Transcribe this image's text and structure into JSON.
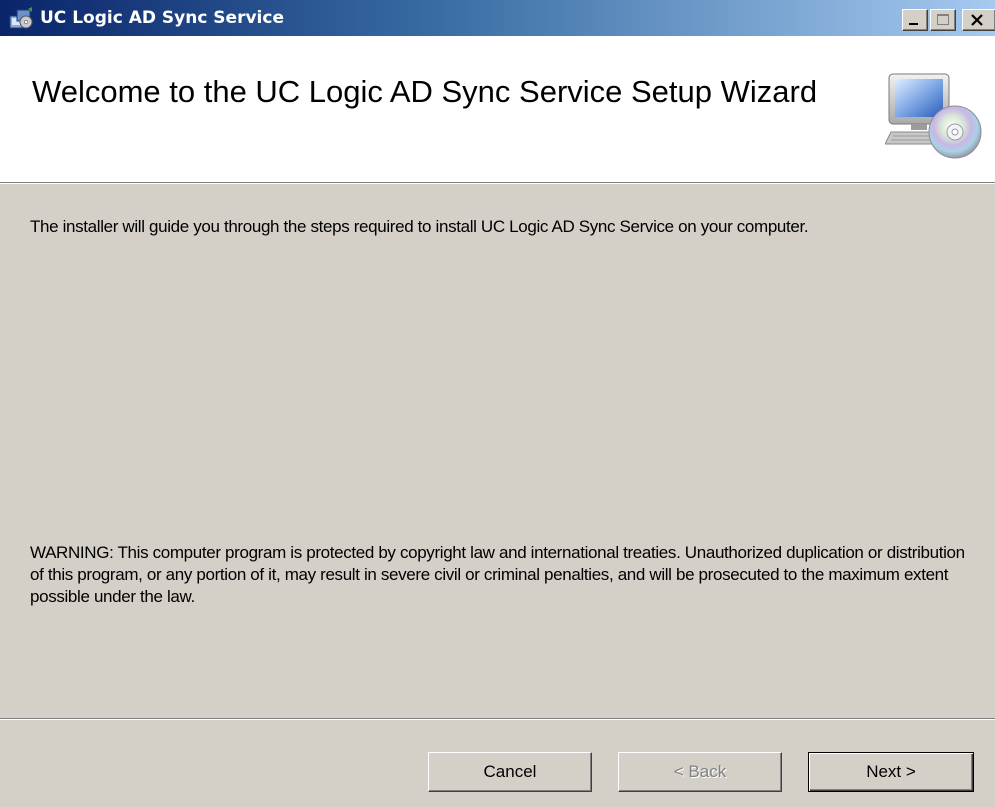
{
  "window": {
    "title": "UC Logic AD Sync Service",
    "icon": "installer-icon",
    "controls": {
      "minimize": "minimize-icon",
      "maximize": "maximize-icon",
      "close": "close-icon"
    }
  },
  "header": {
    "title": "Welcome to the UC Logic AD Sync Service Setup Wizard",
    "image": "computer-cd-icon"
  },
  "content": {
    "intro": "The installer will guide you through the steps required to install UC Logic AD Sync Service on your computer.",
    "warning": "WARNING: This computer program is protected by copyright law and international treaties. Unauthorized duplication or distribution of this program, or any portion of it, may result in severe civil or criminal penalties, and will be prosecuted to the maximum extent possible under the law."
  },
  "buttons": {
    "cancel": "Cancel",
    "back": "< Back",
    "next": "Next >"
  }
}
